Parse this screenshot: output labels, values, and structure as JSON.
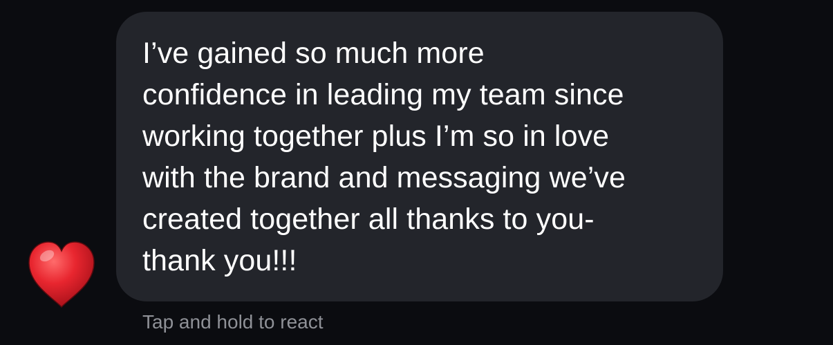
{
  "message": {
    "lines": [
      "I’ve gained so much more",
      "confidence in leading my team since",
      "working together plus I’m so in love",
      "with the brand and messaging we’ve",
      "created together all thanks to you-",
      "thank you!!!"
    ]
  },
  "reaction": {
    "icon": "red-heart-icon",
    "color": "#e8262f"
  },
  "hint": "Tap and hold to react",
  "colors": {
    "background": "#0b0c10",
    "bubble": "#23252b",
    "message_text": "#ffffff",
    "hint_text": "#8f9197"
  }
}
